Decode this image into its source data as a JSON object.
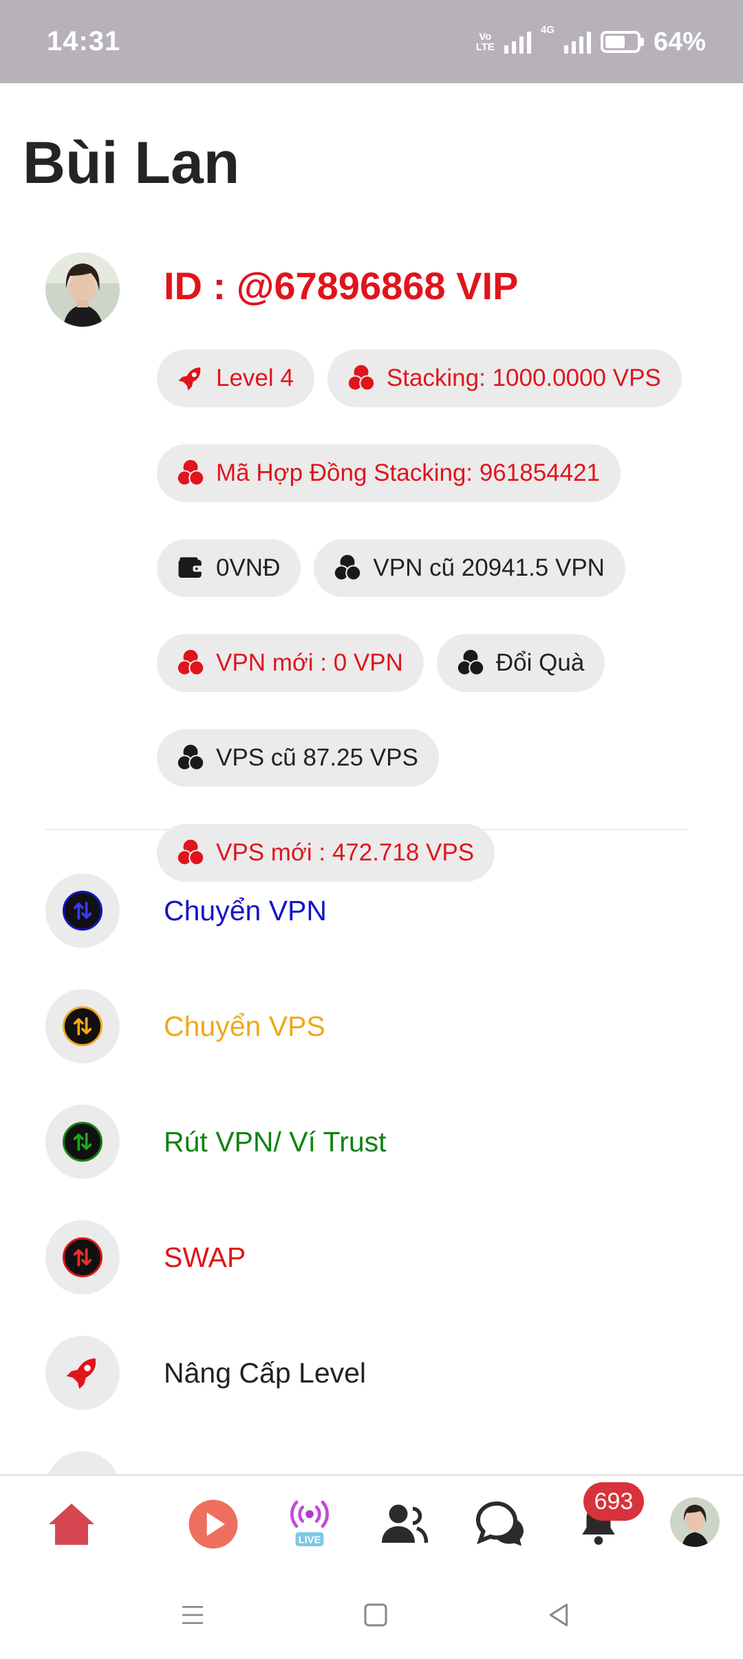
{
  "status_bar": {
    "time": "14:31",
    "volte": "Vo",
    "volte_sub": "LTE",
    "network": "4G",
    "battery": "64%"
  },
  "page_title": "Bùi Lan",
  "profile": {
    "user_id": "ID : @67896868 VIP",
    "chips": {
      "level": "Level 4",
      "stacking": "Stacking: 1000.0000 VPS",
      "contract": "Mã Hợp Đồng Stacking: 961854421",
      "wallet": "0VNĐ",
      "vpn_old": "VPN cũ 20941.5 VPN",
      "vpn_new": "VPN mới : 0 VPN",
      "gift": "Đổi Quà",
      "vps_old": "VPS cũ 87.25 VPS",
      "vps_new": "VPS mới : 472.718 VPS"
    }
  },
  "menu": {
    "transfer_vpn": "Chuyển VPN",
    "transfer_vps": "Chuyển VPS",
    "withdraw": "Rút VPN/ Ví Trust",
    "swap": "SWAP",
    "upgrade": "Nâng Cấp Level"
  },
  "colors": {
    "red": "#e0141c",
    "blue": "#1414c8",
    "amber": "#f0a818",
    "green": "#128212"
  },
  "bottom_nav": {
    "notifications_count": "693",
    "live_label": "LIVE"
  }
}
